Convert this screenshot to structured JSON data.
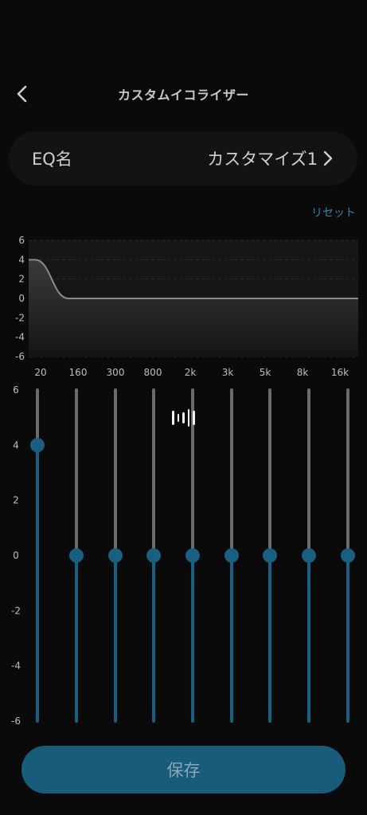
{
  "header": {
    "title": "カスタムイコライザー",
    "back_icon": "chevron-left-icon"
  },
  "eq_name": {
    "label": "EQ名",
    "value": "カスタマイズ1",
    "chevron_icon": "chevron-right-icon"
  },
  "reset_label": "リセット",
  "graph": {
    "y_ticks": [
      "6",
      "4",
      "2",
      "0",
      "-2",
      "-4",
      "-6"
    ],
    "x_ticks": [
      "20",
      "160",
      "300",
      "800",
      "2k",
      "3k",
      "5k",
      "8k",
      "16k"
    ]
  },
  "sliders": {
    "y_ticks": [
      "6",
      "4",
      "2",
      "0",
      "-2",
      "-4",
      "-6"
    ],
    "range": [
      -6,
      6
    ],
    "bands": [
      {
        "freq": "20",
        "gain": 4
      },
      {
        "freq": "160",
        "gain": 0
      },
      {
        "freq": "300",
        "gain": 0
      },
      {
        "freq": "800",
        "gain": 0
      },
      {
        "freq": "2k",
        "gain": 0
      },
      {
        "freq": "3k",
        "gain": 0
      },
      {
        "freq": "5k",
        "gain": 0
      },
      {
        "freq": "8k",
        "gain": 0
      },
      {
        "freq": "16k",
        "gain": 0
      }
    ],
    "indicator_icon": "sound-bars-icon"
  },
  "save_label": "保存",
  "colors": {
    "accent": "#1a5f82",
    "track": "#6b6b6b",
    "reset": "#2f83b1",
    "save_button": "#195b7b"
  }
}
